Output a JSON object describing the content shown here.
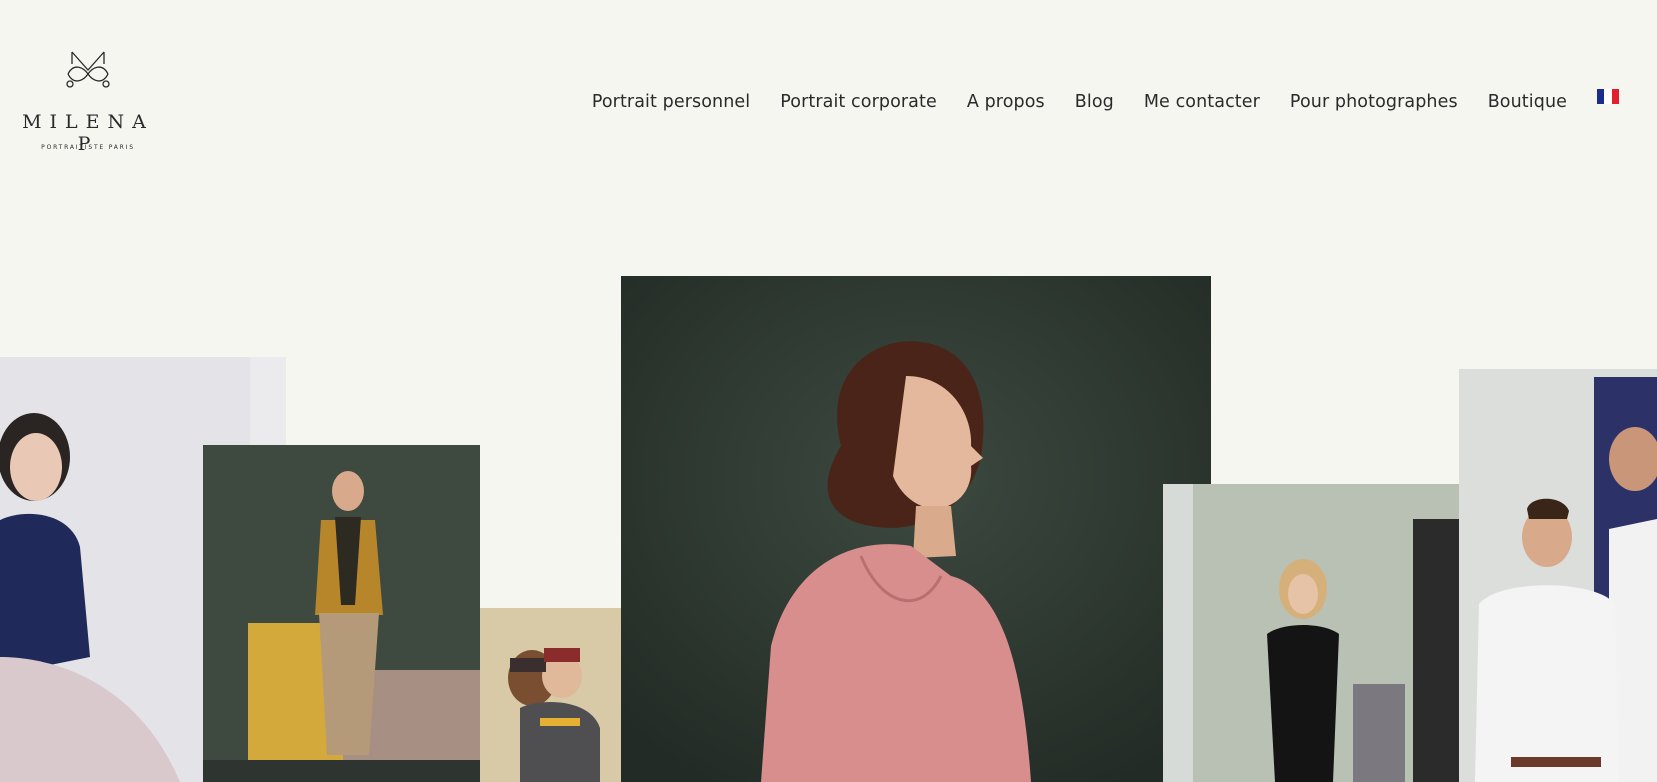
{
  "brand": {
    "name": "MILENA P",
    "tagline": "PORTRAITISTE PARIS"
  },
  "nav": {
    "items": [
      {
        "label": "Portrait personnel"
      },
      {
        "label": "Portrait corporate"
      },
      {
        "label": "A propos"
      },
      {
        "label": "Blog"
      },
      {
        "label": "Me contacter"
      },
      {
        "label": "Pour photographes"
      },
      {
        "label": "Boutique"
      }
    ],
    "language_flag": {
      "icon": "french-flag-icon",
      "colors": [
        "#1a2d8c",
        "#ffffff",
        "#e1202d"
      ]
    }
  },
  "colors": {
    "background": "#f6f6f1",
    "text": "#2a2a2a"
  }
}
